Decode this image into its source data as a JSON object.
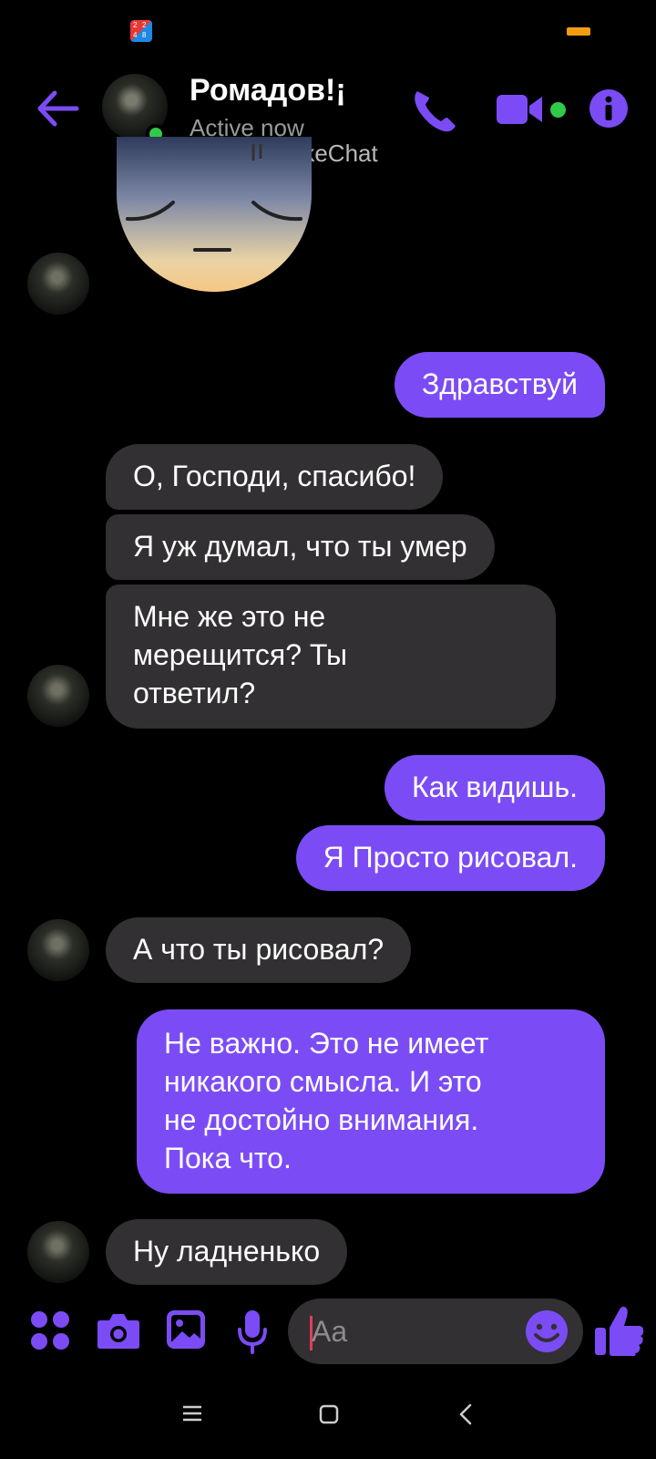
{
  "status_bar": {
    "app_icon": "app-grid-icon",
    "battery_color": "#f39c12"
  },
  "header": {
    "contact_name": "Ромадов!¡",
    "presence": "Active now",
    "watermark": "FakeChat",
    "accent_color": "#7b4cf5",
    "online_color": "#31c94a"
  },
  "messages": [
    {
      "from": "them",
      "text": "О, Господи, спасибо!"
    },
    {
      "from": "them",
      "text": "Я уж думал, что ты умер"
    },
    {
      "from": "them",
      "text": "Мне же это не\nмерещится? Ты\nответил?"
    },
    {
      "from": "me",
      "text": "Здравствуй"
    },
    {
      "from": "me",
      "text": "Как видишь."
    },
    {
      "from": "me",
      "text": "Я Просто рисовал."
    },
    {
      "from": "them",
      "text": "А что ты рисовал?"
    },
    {
      "from": "me",
      "text": "Не важно. Это не имеет\nникакого смысла. И это\nне достойно внимания.\nПока что."
    },
    {
      "from": "them",
      "text": "Ну ладненько"
    }
  ],
  "composer": {
    "placeholder": "Aa"
  },
  "colors": {
    "outgoing_bubble": "#7b4cf5",
    "incoming_bubble": "#323032",
    "background": "#000000"
  }
}
